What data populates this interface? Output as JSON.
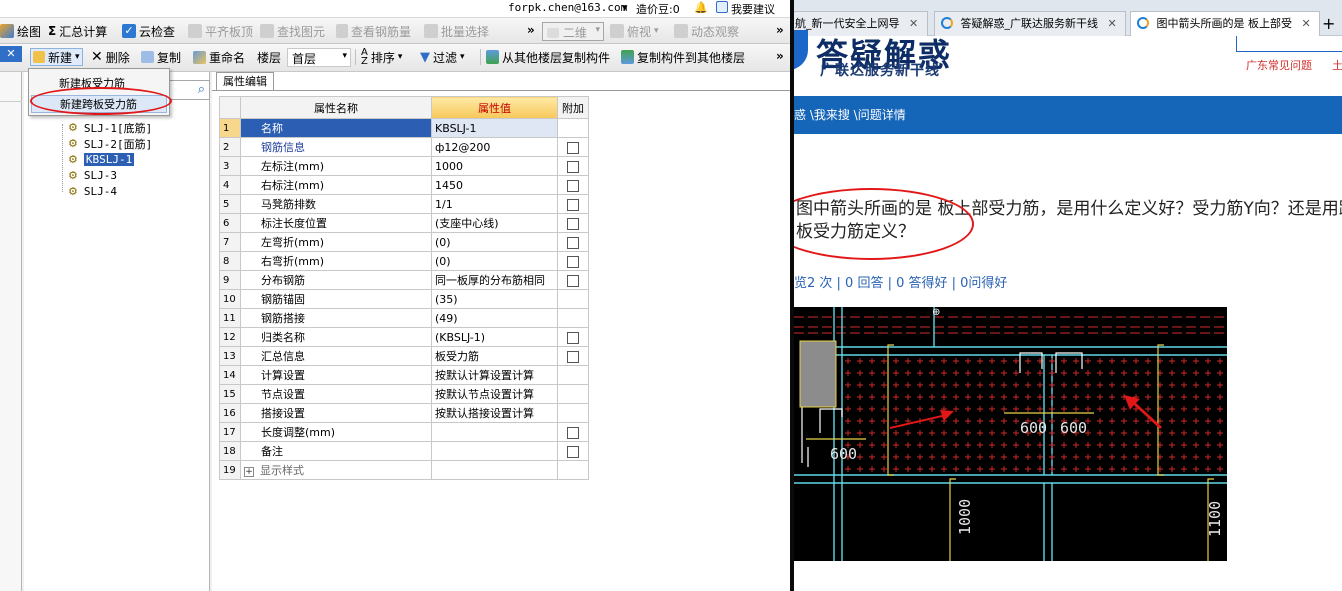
{
  "app": {
    "topbar": {
      "account": "forpk.chen@163.com",
      "account_arrow": "▾",
      "price_beans": "造价豆:0",
      "suggest": "我要建议"
    },
    "toolbar1": [
      {
        "label": "绘图",
        "icon": "draw-icon",
        "disabled": false
      },
      {
        "label": "汇总计算",
        "icon": "sigma-icon",
        "disabled": false
      },
      {
        "label": "云检查",
        "icon": "cloud-check-icon",
        "disabled": false
      },
      {
        "label": "平齐板顶",
        "icon": "align-top-icon",
        "disabled": true
      },
      {
        "label": "查找图元",
        "icon": "find-icon",
        "disabled": true
      },
      {
        "label": "查看钢筋量",
        "icon": "rebar-view-icon",
        "disabled": true
      },
      {
        "label": "批量选择",
        "icon": "batch-select-icon",
        "disabled": true
      },
      {
        "label": "俯视",
        "icon": "topview-icon",
        "disabled": true
      },
      {
        "label": "动态观察",
        "icon": "orbit-icon",
        "disabled": true
      }
    ],
    "view_combo": "二维",
    "toolbar2": {
      "new": "新建",
      "delete": "删除",
      "copy": "复制",
      "rename": "重命名",
      "floor_label": "楼层",
      "floor_value": "首层",
      "sort": "排序",
      "filter": "过滤",
      "copy_from": "从其他楼层复制构件",
      "copy_to": "复制构件到其他楼层"
    },
    "overflow": "»",
    "menu": {
      "item1": "新建板受力筋",
      "item2": "新建跨板受力筋"
    },
    "tree": [
      {
        "label": "SLJ-1[底筋]",
        "selected": false
      },
      {
        "label": "SLJ-2[面筋]",
        "selected": false
      },
      {
        "label": "KBSLJ-1",
        "selected": true
      },
      {
        "label": "SLJ-3",
        "selected": false
      },
      {
        "label": "SLJ-4",
        "selected": false
      }
    ],
    "props": {
      "tab": "属性编辑",
      "col_name": "属性名称",
      "col_value": "属性值",
      "col_attach": "附加",
      "rows": [
        {
          "n": "1",
          "name": "名称",
          "value": "KBSLJ-1",
          "cb": false,
          "blue": false
        },
        {
          "n": "2",
          "name": "钢筋信息",
          "value": "ф12@200",
          "cb": true,
          "blue": true
        },
        {
          "n": "3",
          "name": "左标注(mm)",
          "value": "1000",
          "cb": true,
          "blue": false
        },
        {
          "n": "4",
          "name": "右标注(mm)",
          "value": "1450",
          "cb": true,
          "blue": false
        },
        {
          "n": "5",
          "name": "马凳筋排数",
          "value": "1/1",
          "cb": true,
          "blue": false
        },
        {
          "n": "6",
          "name": "标注长度位置",
          "value": "(支座中心线)",
          "cb": true,
          "blue": false
        },
        {
          "n": "7",
          "name": "左弯折(mm)",
          "value": "(0)",
          "cb": true,
          "blue": false
        },
        {
          "n": "8",
          "name": "右弯折(mm)",
          "value": "(0)",
          "cb": true,
          "blue": false
        },
        {
          "n": "9",
          "name": "分布钢筋",
          "value": "同一板厚的分布筋相同",
          "cb": true,
          "blue": false
        },
        {
          "n": "10",
          "name": "钢筋锚固",
          "value": "(35)",
          "cb": false,
          "blue": false
        },
        {
          "n": "11",
          "name": "钢筋搭接",
          "value": "(49)",
          "cb": false,
          "blue": false
        },
        {
          "n": "12",
          "name": "归类名称",
          "value": "(KBSLJ-1)",
          "cb": true,
          "blue": false
        },
        {
          "n": "13",
          "name": "汇总信息",
          "value": "板受力筋",
          "cb": true,
          "blue": false
        },
        {
          "n": "14",
          "name": "计算设置",
          "value": "按默认计算设置计算",
          "cb": false,
          "blue": false
        },
        {
          "n": "15",
          "name": "节点设置",
          "value": "按默认节点设置计算",
          "cb": false,
          "blue": false
        },
        {
          "n": "16",
          "name": "搭接设置",
          "value": "按默认搭接设置计算",
          "cb": false,
          "blue": false
        },
        {
          "n": "17",
          "name": "长度调整(mm)",
          "value": "",
          "cb": true,
          "blue": false
        },
        {
          "n": "18",
          "name": "备注",
          "value": "",
          "cb": true,
          "blue": false
        },
        {
          "n": "19",
          "name": "显示样式",
          "value": "",
          "cb": false,
          "blue": false,
          "expand": true
        }
      ]
    }
  },
  "browser": {
    "tabs": [
      {
        "label": "航_新一代安全上网导",
        "active": false
      },
      {
        "label": "答疑解惑_广联达服务新干线",
        "active": false
      },
      {
        "label": "图中箭头所画的是 板上部受",
        "active": true
      }
    ],
    "new_tab": "+",
    "logo_text": "答疑解惑",
    "slogan": "广联达服务新干线",
    "hotlink": "广东常见问题",
    "hotlink2": "土",
    "breadcrumb": "惑 \\我来搜 \\问题详情",
    "question": "图中箭头所画的是 板上部受力筋，是用什么定义好？受力筋Y向？还是用跨板受力筋定义？",
    "stats": "览2 次 | 0 回答 | 0 答得好 | 0问得好",
    "cad_labels": [
      "600",
      "600",
      "600",
      "1000",
      "1100"
    ]
  },
  "colors": {
    "annotation": "#e21818",
    "selection": "#2c5fb3",
    "navbar": "#1565b8",
    "cad_red": "#d42a2a",
    "cad_yellow": "#e6d24a",
    "cad_cyan": "#5fd7e8"
  }
}
